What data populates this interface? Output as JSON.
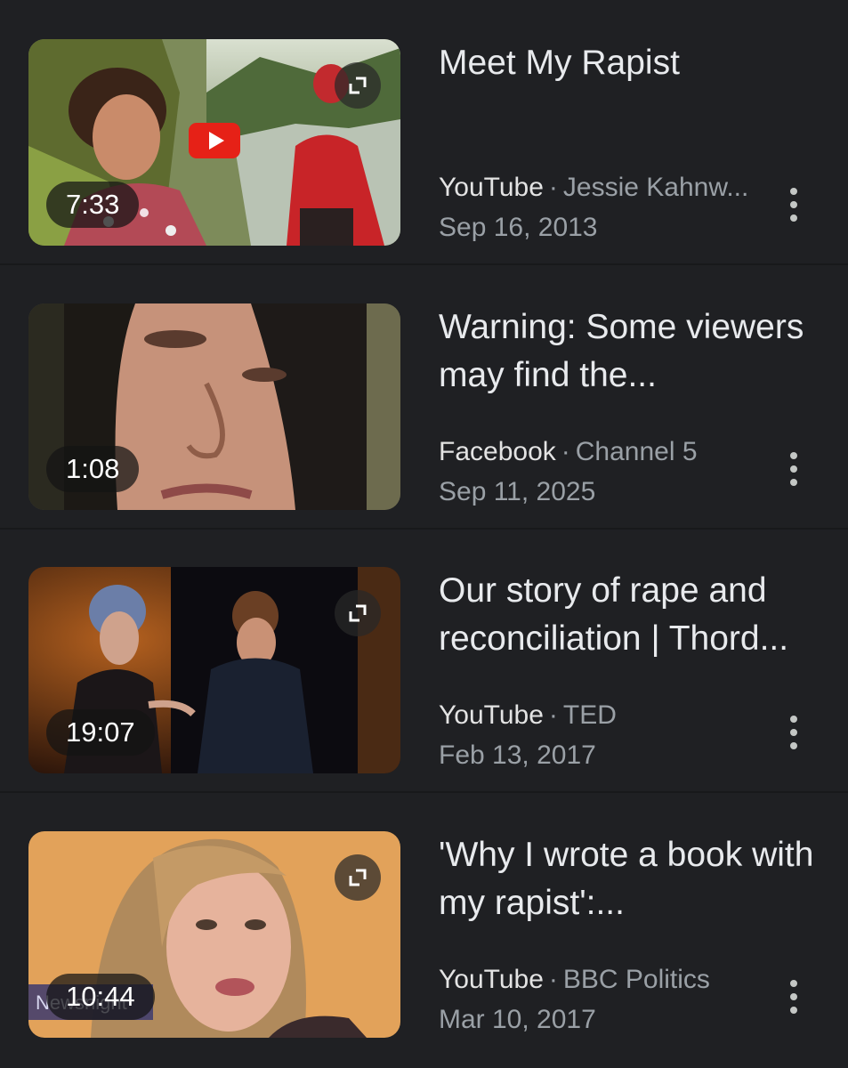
{
  "results": [
    {
      "title": "Meet My Rapist",
      "duration": "7:33",
      "source": "YouTube",
      "separator": "·",
      "channel": "Jessie Kahnw...",
      "date": "Sep 16, 2013",
      "has_expand": true,
      "has_play_badge": true
    },
    {
      "title": "Warning: Some viewers may find the...",
      "duration": "1:08",
      "source": "Facebook",
      "separator": "·",
      "channel": "Channel 5",
      "date": "Sep 11, 2025",
      "has_expand": false,
      "has_play_badge": false
    },
    {
      "title": "Our story of rape and reconciliation | Thord...",
      "duration": "19:07",
      "source": "YouTube",
      "separator": "·",
      "channel": "TED",
      "date": "Feb 13, 2017",
      "has_expand": true,
      "has_play_badge": false
    },
    {
      "title": "'Why I wrote a book with my rapist':...",
      "duration": "10:44",
      "source": "YouTube",
      "separator": "·",
      "channel": "BBC Politics",
      "date": "Mar 10, 2017",
      "has_expand": true,
      "has_play_badge": false,
      "thumbnail_overlay_text": "Newsnight"
    }
  ],
  "icons": {
    "expand": "expand-icon",
    "more": "more-vert-icon",
    "play": "youtube-play-icon"
  },
  "colors": {
    "background": "#1f2023",
    "title": "#e8eaed",
    "secondary": "#9aa0a6",
    "play_red": "#e62117"
  }
}
